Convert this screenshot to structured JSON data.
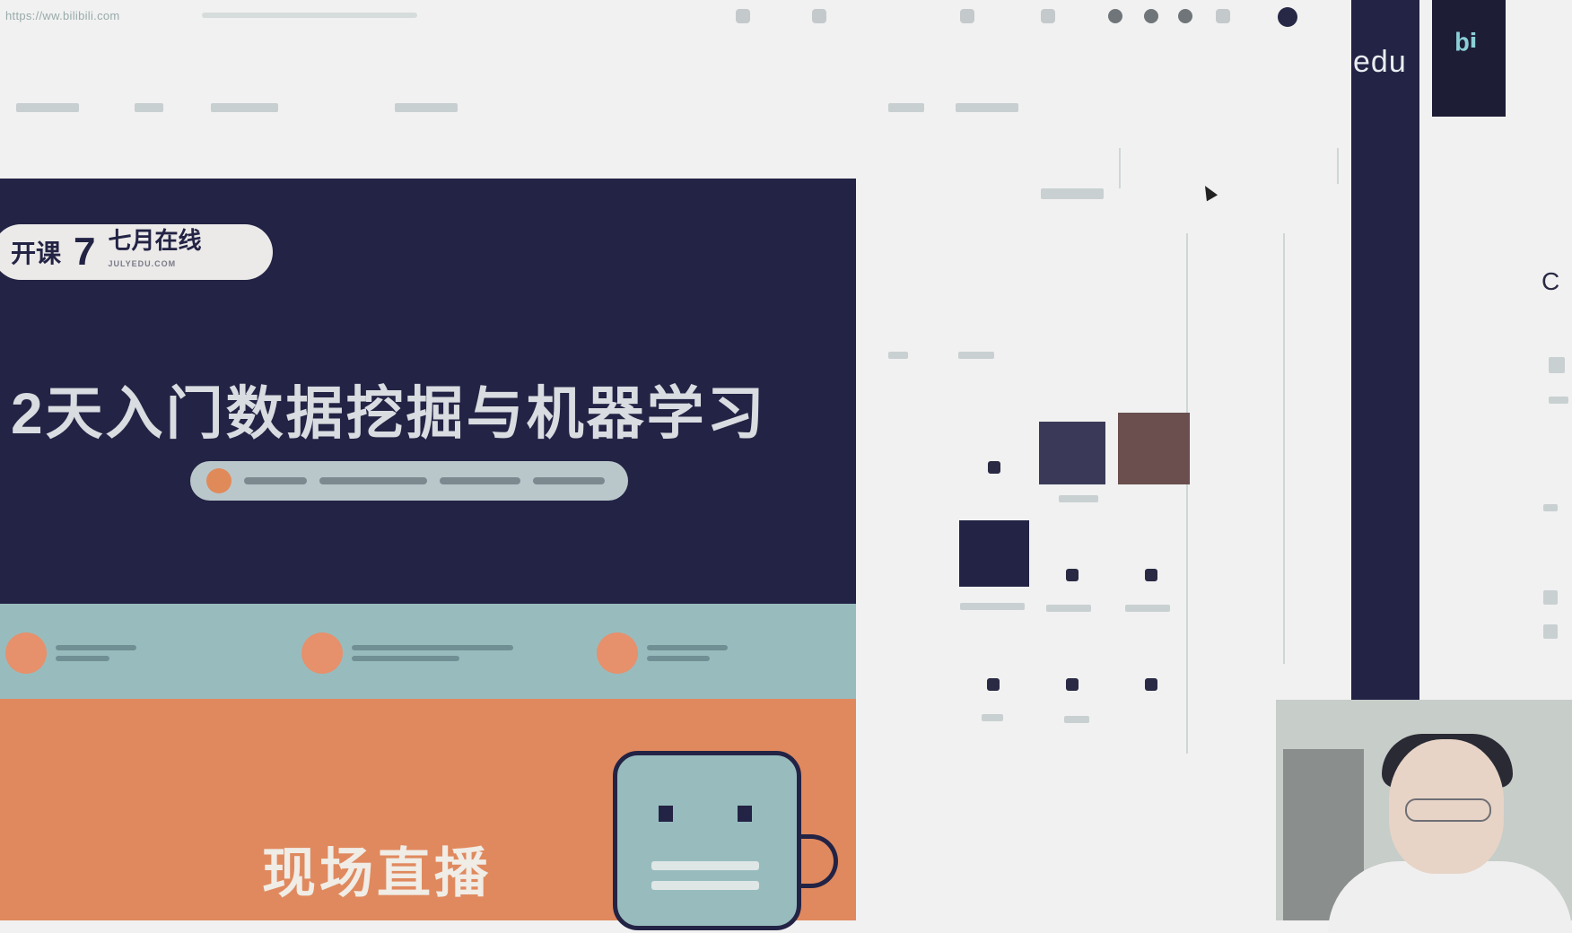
{
  "browser": {
    "url": "https://ww.bilibili.com",
    "toolbar_icons": [
      "back-icon",
      "forward-icon",
      "refresh-icon",
      "bookmark-icon",
      "download-icon",
      "extensions-icon",
      "menu-icon"
    ]
  },
  "banner": {
    "badge_left": "开课",
    "badge_number": "7",
    "badge_right": "七月在线",
    "badge_sub": "JULYEDU.COM",
    "title": "2天入门数据挖掘与机器学习"
  },
  "promo": {
    "title": "现场直播"
  },
  "side": {
    "edu_text": "edu",
    "c_text": "C",
    "marks": [
      "",
      "",
      ""
    ]
  },
  "colors": {
    "navy": "#232345",
    "teal": "#98bcbd",
    "orange": "#e0895e",
    "paper": "#f1f1f1"
  }
}
